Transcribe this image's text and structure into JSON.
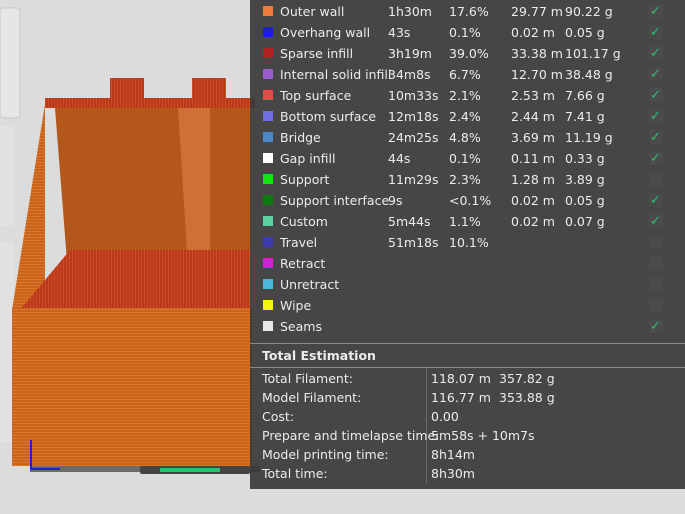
{
  "legend": [
    {
      "name": "Outer wall",
      "time": "1h30m",
      "pct": "17.6%",
      "length": "29.77 m",
      "weight": "90.22 g",
      "color": "#ef7a3c",
      "checked": true
    },
    {
      "name": "Overhang wall",
      "time": "43s",
      "pct": "0.1%",
      "length": "0.02 m",
      "weight": "0.05 g",
      "color": "#1c1ce0",
      "checked": true
    },
    {
      "name": "Sparse infill",
      "time": "3h19m",
      "pct": "39.0%",
      "length": "33.38 m",
      "weight": "101.17 g",
      "color": "#b22222",
      "checked": true
    },
    {
      "name": "Internal solid infill",
      "time": "34m8s",
      "pct": "6.7%",
      "length": "12.70 m",
      "weight": "38.48 g",
      "color": "#9a5ccc",
      "checked": true
    },
    {
      "name": "Top surface",
      "time": "10m33s",
      "pct": "2.1%",
      "length": "2.53 m",
      "weight": "7.66 g",
      "color": "#e84a4a",
      "checked": true
    },
    {
      "name": "Bottom surface",
      "time": "12m18s",
      "pct": "2.4%",
      "length": "2.44 m",
      "weight": "7.41 g",
      "color": "#6e6ee0",
      "checked": true
    },
    {
      "name": "Bridge",
      "time": "24m25s",
      "pct": "4.8%",
      "length": "3.69 m",
      "weight": "11.19 g",
      "color": "#4c88c6",
      "checked": true
    },
    {
      "name": "Gap infill",
      "time": "44s",
      "pct": "0.1%",
      "length": "0.11 m",
      "weight": "0.33 g",
      "color": "#ffffff",
      "checked": true
    },
    {
      "name": "Support",
      "time": "11m29s",
      "pct": "2.3%",
      "length": "1.28 m",
      "weight": "3.89 g",
      "color": "#12e412",
      "checked": false
    },
    {
      "name": "Support interface",
      "time": "9s",
      "pct": "<0.1%",
      "length": "0.02 m",
      "weight": "0.05 g",
      "color": "#0f7a0f",
      "checked": true
    },
    {
      "name": "Custom",
      "time": "5m44s",
      "pct": "1.1%",
      "length": "0.02 m",
      "weight": "0.07 g",
      "color": "#5cd0a0",
      "checked": true
    },
    {
      "name": "Travel",
      "time": "51m18s",
      "pct": "10.1%",
      "length": "",
      "weight": "",
      "color": "#3c3cb0",
      "checked": false
    },
    {
      "name": "Retract",
      "time": "",
      "pct": "",
      "length": "",
      "weight": "",
      "color": "#d41fd4",
      "checked": false
    },
    {
      "name": "Unretract",
      "time": "",
      "pct": "",
      "length": "",
      "weight": "",
      "color": "#4ab8d8",
      "checked": false
    },
    {
      "name": "Wipe",
      "time": "",
      "pct": "",
      "length": "",
      "weight": "",
      "color": "#f5f50a",
      "checked": false
    },
    {
      "name": "Seams",
      "time": "",
      "pct": "",
      "length": "",
      "weight": "",
      "color": "#e8e8e8",
      "checked": true
    }
  ],
  "total": {
    "title": "Total Estimation",
    "rows": [
      {
        "label": "Total Filament:",
        "v1": "118.07 m",
        "v2": "357.82 g"
      },
      {
        "label": "Model Filament:",
        "v1": "116.77 m",
        "v2": "353.88 g"
      },
      {
        "label": "Cost:",
        "v1": "0.00",
        "v2": ""
      },
      {
        "label": "Prepare and timelapse time:",
        "v1": "5m58s + 10m7s",
        "v2": ""
      },
      {
        "label": "Model printing time:",
        "v1": "8h14m",
        "v2": ""
      },
      {
        "label": "Total time:",
        "v1": "8h30m",
        "v2": ""
      }
    ]
  },
  "colors": {
    "print": "#c8641c",
    "panel": "#3a3a3a",
    "check": "#2fbf6e"
  }
}
